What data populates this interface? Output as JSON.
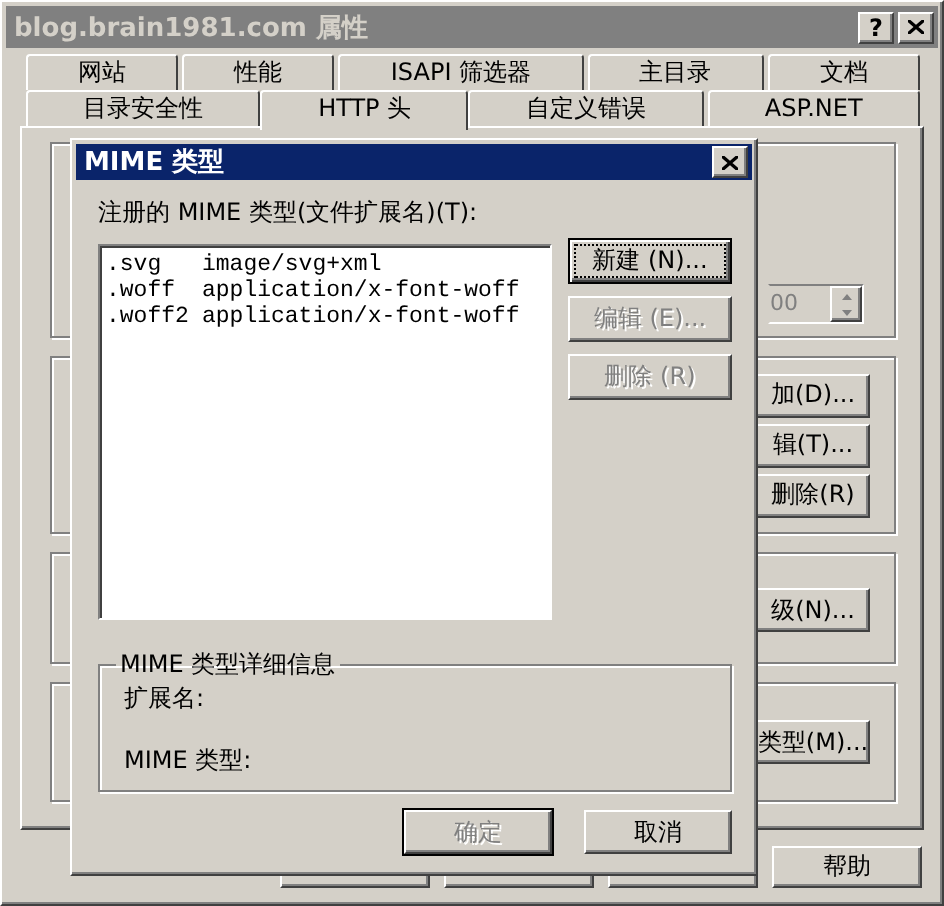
{
  "window": {
    "title": "blog.brain1981.com 属性",
    "help_button": "?"
  },
  "tab_rows": [
    {
      "tabs": [
        {
          "label": "网站",
          "selected": false
        },
        {
          "label": "性能",
          "selected": false
        },
        {
          "label": "ISAPI 筛选器",
          "selected": false
        },
        {
          "label": "主目录",
          "selected": false
        },
        {
          "label": "文档",
          "selected": false
        }
      ]
    },
    {
      "tabs": [
        {
          "label": "目录安全性",
          "selected": false
        },
        {
          "label": "HTTP 头",
          "selected": true
        },
        {
          "label": "自定义错误",
          "selected": false
        },
        {
          "label": "ASP.NET",
          "selected": false
        }
      ]
    }
  ],
  "panel": {
    "spin_value": "00",
    "spin_disabled": true,
    "group_buttons": [
      [
        {
          "label": "加(D)..."
        },
        {
          "label": "辑(T)..."
        },
        {
          "label": "删除(R)"
        }
      ],
      [
        {
          "label": "级(N)..."
        }
      ],
      [
        {
          "label": "类型(M)..."
        }
      ]
    ]
  },
  "bottom_buttons": [
    {
      "kind": "covered"
    },
    {
      "kind": "covered"
    },
    {
      "kind": "covered"
    },
    {
      "kind": "labeled",
      "label": "帮助"
    }
  ],
  "dialog": {
    "title": "MIME 类型",
    "list_label": "注册的 MIME 类型(文件扩展名)(T):",
    "mime_types": [
      {
        "extension": ".svg",
        "type": "image/svg+xml"
      },
      {
        "extension": ".woff",
        "type": "application/x-font-woff"
      },
      {
        "extension": ".woff2",
        "type": "application/x-font-woff"
      }
    ],
    "side_buttons": [
      {
        "label": "新建 (N)...",
        "disabled": false,
        "focused": true
      },
      {
        "label": "编辑 (E)...",
        "disabled": true,
        "focused": false
      },
      {
        "label": "删除 (R)",
        "disabled": true,
        "focused": false
      }
    ],
    "details": {
      "title": "MIME 类型详细信息",
      "fields": [
        {
          "label": "扩展名:"
        },
        {
          "label": "MIME 类型:"
        }
      ]
    },
    "buttons": [
      {
        "label": "确定",
        "disabled": true,
        "default": true
      },
      {
        "label": "取消",
        "disabled": false,
        "default": false
      }
    ]
  }
}
